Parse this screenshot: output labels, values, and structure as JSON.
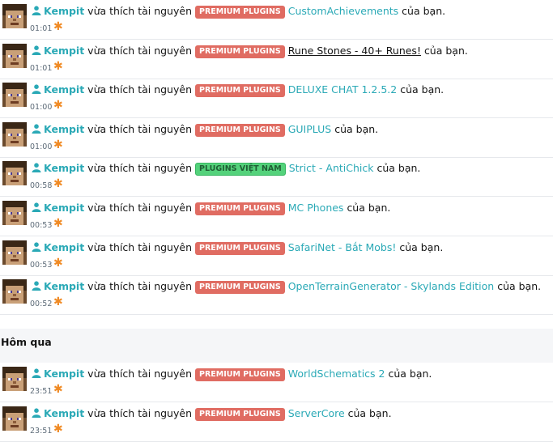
{
  "today_items": [
    {
      "user": "Kempit",
      "verb": "vừa thích tài nguyên",
      "badge": "PREMIUM PLUGINS",
      "badge_type": "premium",
      "resource": "CustomAchievements",
      "resource_style": "link",
      "suffix": "của bạn.",
      "time": "01:01"
    },
    {
      "user": "Kempit",
      "verb": "vừa thích tài nguyên",
      "badge": "PREMIUM PLUGINS",
      "badge_type": "premium",
      "resource": " Rune Stones - 40+ Runes!",
      "resource_style": "dark",
      "suffix": "của bạn.",
      "time": "01:01"
    },
    {
      "user": "Kempit",
      "verb": "vừa thích tài nguyên",
      "badge": "PREMIUM PLUGINS",
      "badge_type": "premium",
      "resource": "DELUXE CHAT 1.2.5.2",
      "resource_style": "link",
      "suffix": "của bạn.",
      "time": "01:00"
    },
    {
      "user": "Kempit",
      "verb": "vừa thích tài nguyên",
      "badge": "PREMIUM PLUGINS",
      "badge_type": "premium",
      "resource": "GUIPLUS",
      "resource_style": "link",
      "suffix": "của bạn.",
      "time": "01:00"
    },
    {
      "user": "Kempit",
      "verb": "vừa thích tài nguyên",
      "badge": "PLUGINS VIỆT NAM",
      "badge_type": "vn",
      "resource": "Strict - AntiChick",
      "resource_style": "link",
      "suffix": "của bạn.",
      "time": "00:58"
    },
    {
      "user": "Kempit",
      "verb": "vừa thích tài nguyên",
      "badge": "PREMIUM PLUGINS",
      "badge_type": "premium",
      "resource": "MC Phones",
      "resource_style": "link",
      "suffix": "của bạn.",
      "time": "00:53"
    },
    {
      "user": "Kempit",
      "verb": "vừa thích tài nguyên",
      "badge": "PREMIUM PLUGINS",
      "badge_type": "premium",
      "resource": "SafariNet - Bắt Mobs!",
      "resource_style": "link",
      "suffix": "của bạn.",
      "time": "00:53"
    },
    {
      "user": "Kempit",
      "verb": "vừa thích tài nguyên",
      "badge": "PREMIUM PLUGINS",
      "badge_type": "premium",
      "resource": "OpenTerrainGenerator - Skylands Edition",
      "resource_style": "link",
      "suffix": "của bạn.",
      "time": "00:52"
    }
  ],
  "section": {
    "title": "Hôm qua"
  },
  "yesterday_items": [
    {
      "user": "Kempit",
      "verb": "vừa thích tài nguyên",
      "badge": "PREMIUM PLUGINS",
      "badge_type": "premium",
      "resource": "WorldSchematics 2",
      "resource_style": "link",
      "suffix": "của bạn.",
      "time": "23:51"
    },
    {
      "user": "Kempit",
      "verb": "vừa thích tài nguyên",
      "badge": "PREMIUM PLUGINS",
      "badge_type": "premium",
      "resource": "ServerCore",
      "resource_style": "link",
      "suffix": "của bạn.",
      "time": "23:51"
    }
  ],
  "icons": {
    "user": "user-icon",
    "alert": "asterisk-icon",
    "avatar": "minecraft-skin-avatar"
  },
  "colors": {
    "link": "#2aa9b6",
    "premium": "#e06c62",
    "vn": "#54d27b",
    "star": "#f08a24"
  }
}
